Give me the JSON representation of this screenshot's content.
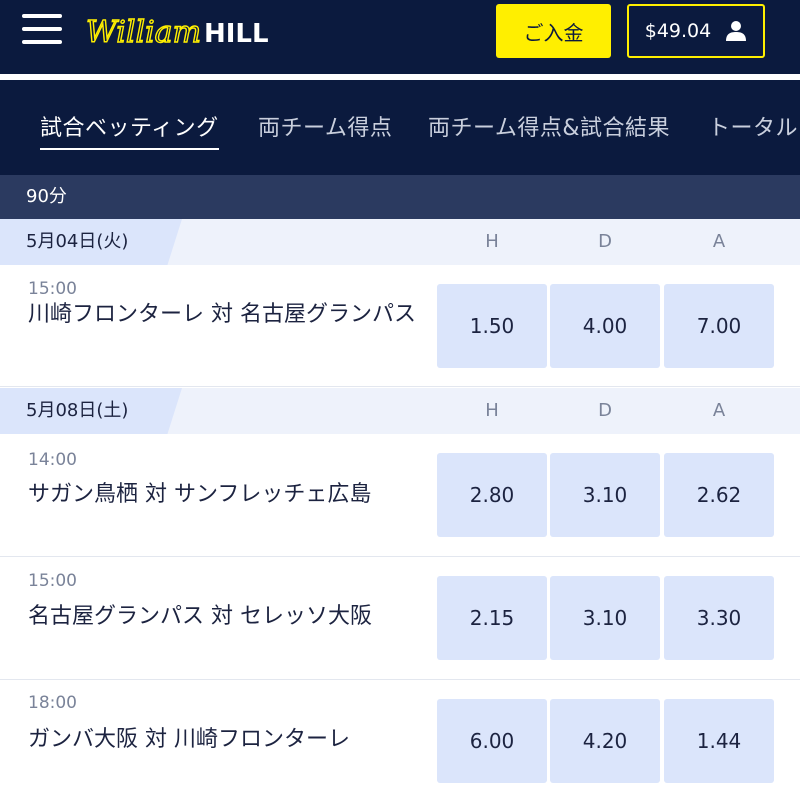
{
  "header": {
    "logo_text": "William HILL",
    "deposit_label": "ご入金",
    "balance": "$49.04",
    "menu_icon": "hamburger-menu-icon",
    "user_icon": "user-icon",
    "colors": {
      "navy": "#0b1a3e",
      "yellow": "#ffef00"
    }
  },
  "tabs": [
    {
      "label": "試合ベッティング",
      "active": true
    },
    {
      "label": "両チーム得点"
    },
    {
      "label": "両チーム得点&試合結果"
    },
    {
      "label": "トータル"
    }
  ],
  "section_title": "90分",
  "column_headers": [
    "H",
    "D",
    "A"
  ],
  "groups": [
    {
      "date": "5月04日(火)",
      "matches": [
        {
          "time": "15:00",
          "name": "川崎フロンターレ 対 名古屋グランパス",
          "odds": [
            "1.50",
            "4.00",
            "7.00"
          ]
        }
      ]
    },
    {
      "date": "5月08日(土)",
      "matches": [
        {
          "time": "14:00",
          "name": "サガン鳥栖 対 サンフレッチェ広島",
          "odds": [
            "2.80",
            "3.10",
            "2.62"
          ]
        },
        {
          "time": "15:00",
          "name": "名古屋グランパス 対 セレッソ大阪",
          "odds": [
            "2.15",
            "3.10",
            "3.30"
          ]
        },
        {
          "time": "18:00",
          "name": "ガンバ大阪 対 川崎フロンターレ",
          "odds": [
            "6.00",
            "4.20",
            "1.44"
          ]
        }
      ]
    }
  ]
}
